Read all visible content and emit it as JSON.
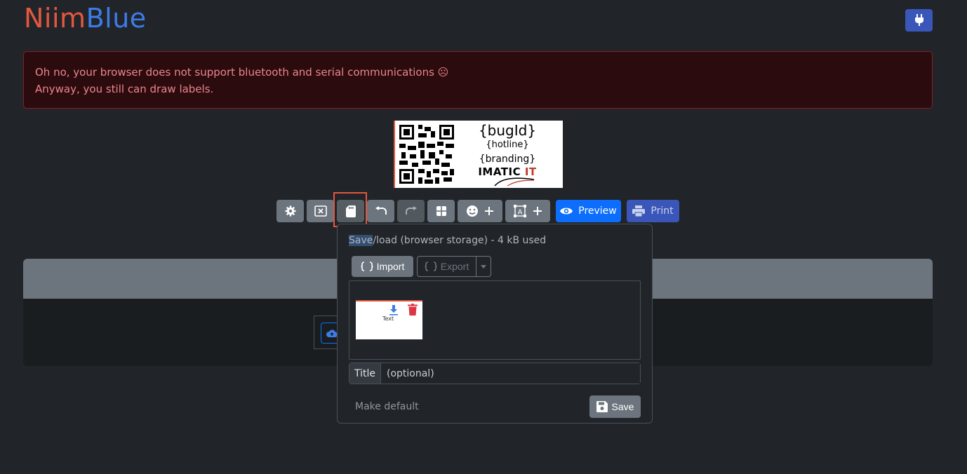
{
  "brand": {
    "part1": "Niim",
    "part2": "Blue"
  },
  "alert": {
    "line1": "Oh no, your browser does not support bluetooth and serial communications ☹",
    "line2": "Anyway, you still can draw labels."
  },
  "label": {
    "bug_id": "{bugId}",
    "hotline": "{hotline}",
    "branding": "{branding}",
    "logo_main": "IMATIC",
    "logo_suffix": "IT"
  },
  "toolbar": {
    "preview_label": "Preview",
    "print_label": "Print"
  },
  "popover": {
    "title_selected": "Save",
    "title_rest": "/load (browser storage) - 4 kB used",
    "import_label": "Import",
    "export_label": "Export",
    "thumb_text": "Text",
    "title_label": "Title",
    "title_placeholder": "(optional)",
    "make_default_label": "Make default",
    "save_label": "Save"
  },
  "colors": {
    "brand_red": "#e4573e",
    "brand_blue": "#3d7be8",
    "primary": "#0d6efd",
    "danger_text": "#ea868f"
  }
}
